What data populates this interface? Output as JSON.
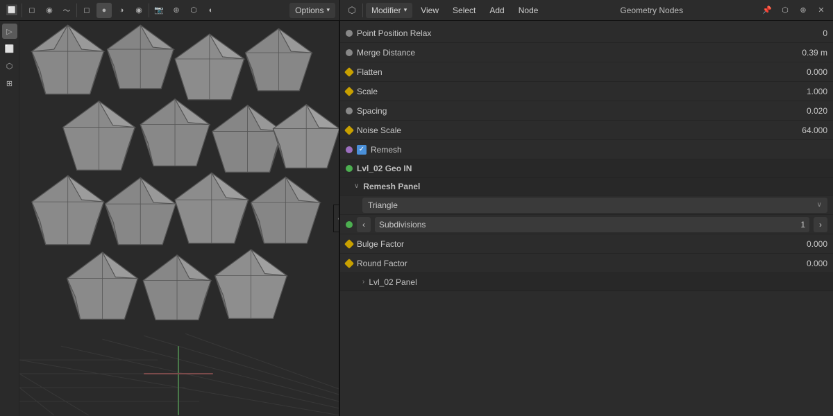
{
  "topbar_left": {
    "buttons": [
      "⟳",
      "▸",
      "🔊",
      "📷"
    ],
    "options_label": "Options"
  },
  "topbar_right": {
    "menu": {
      "modifier": "Modifier",
      "view": "View",
      "select": "Select",
      "add": "Add",
      "node": "Node"
    },
    "title": "Geometry Nodes",
    "pin_icon": "📌"
  },
  "viewport": {
    "header_icons": [
      "◻",
      "●",
      "◉",
      "⬡",
      "◑",
      "◻",
      "⊕"
    ],
    "overlay_label": "Options",
    "collapse_icon": "‹"
  },
  "properties": {
    "rows": [
      {
        "id": "point_position_relax",
        "dot": "gray",
        "label": "Point Position Relax",
        "value": "0"
      },
      {
        "id": "merge_distance",
        "dot": "gray",
        "label": "Merge Distance",
        "value": "0.39 m"
      },
      {
        "id": "flatten",
        "dot": "diamond-yellow",
        "label": "Flatten",
        "value": "0.000"
      },
      {
        "id": "scale",
        "dot": "diamond-yellow",
        "label": "Scale",
        "value": "1.000"
      },
      {
        "id": "spacing",
        "dot": "gray",
        "label": "Spacing",
        "value": "0.020"
      },
      {
        "id": "noise_scale",
        "dot": "diamond-yellow",
        "label": "Noise Scale",
        "value": "64.000"
      }
    ],
    "checkbox_row": {
      "checked": true,
      "label": "Remesh",
      "dot": "purple"
    },
    "section_lvl02": {
      "dot": "green",
      "label": "Lvl_02 Geo IN"
    },
    "section_remesh": {
      "chevron": "∨",
      "label": "Remesh Panel"
    },
    "dropdown": {
      "value": "Triangle",
      "arrow": "∨"
    },
    "stepper": {
      "dot": "green",
      "label": "Subdivisions",
      "value": "1",
      "left_arrow": "‹",
      "right_arrow": "›"
    },
    "bottom_rows": [
      {
        "id": "bulge_factor",
        "dot": "diamond-yellow",
        "label": "Bulge Factor",
        "value": "0.000"
      },
      {
        "id": "round_factor",
        "dot": "diamond-yellow",
        "label": "Round Factor",
        "value": "0.000"
      }
    ],
    "collapsed_panel": {
      "chevron": "›",
      "label": "Lvl_02 Panel"
    }
  }
}
